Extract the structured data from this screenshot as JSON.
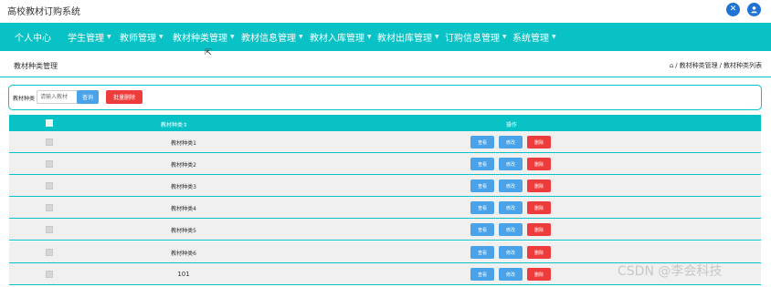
{
  "app": {
    "title": "高校教材订购系统"
  },
  "top_icons": [
    "wrench-icon",
    "user-icon"
  ],
  "nav": {
    "items": [
      {
        "label": "个人中心",
        "caret": false
      },
      {
        "label": "学生管理",
        "caret": true
      },
      {
        "label": "教师管理",
        "caret": true
      },
      {
        "label": "教材种类管理",
        "caret": true
      },
      {
        "label": "教材信息管理",
        "caret": true
      },
      {
        "label": "教材入库管理",
        "caret": true
      },
      {
        "label": "教材出库管理",
        "caret": true
      },
      {
        "label": "订购信息管理",
        "caret": true
      },
      {
        "label": "系统管理",
        "caret": true
      }
    ]
  },
  "section": {
    "title": "教材种类管理",
    "breadcrumb": {
      "home_icon": "home-icon",
      "sep": "/",
      "level1": "教材种类管理",
      "level2": "教材种类列表"
    }
  },
  "search": {
    "label": "教材种类",
    "placeholder": "请输入教材",
    "query_label": "查询",
    "batch_delete_label": "批量删除"
  },
  "table": {
    "headers": {
      "name": "教材种类",
      "sort_icon": "sort-icon",
      "actions": "操作"
    },
    "rows": [
      {
        "name": "教材种类1"
      },
      {
        "name": "教材种类2"
      },
      {
        "name": "教材种类3"
      },
      {
        "name": "教材种类4"
      },
      {
        "name": "教材种类5"
      },
      {
        "name": "教材种类6"
      },
      {
        "name": "101"
      }
    ],
    "action_labels": {
      "view": "查看",
      "edit": "修改",
      "delete": "删除"
    }
  },
  "watermark": "CSDN @李会科技",
  "colors": {
    "teal": "#08c2c5",
    "blue": "#4aa3e8",
    "red": "#ee3b3b",
    "icon_blue": "#1e73d6"
  }
}
